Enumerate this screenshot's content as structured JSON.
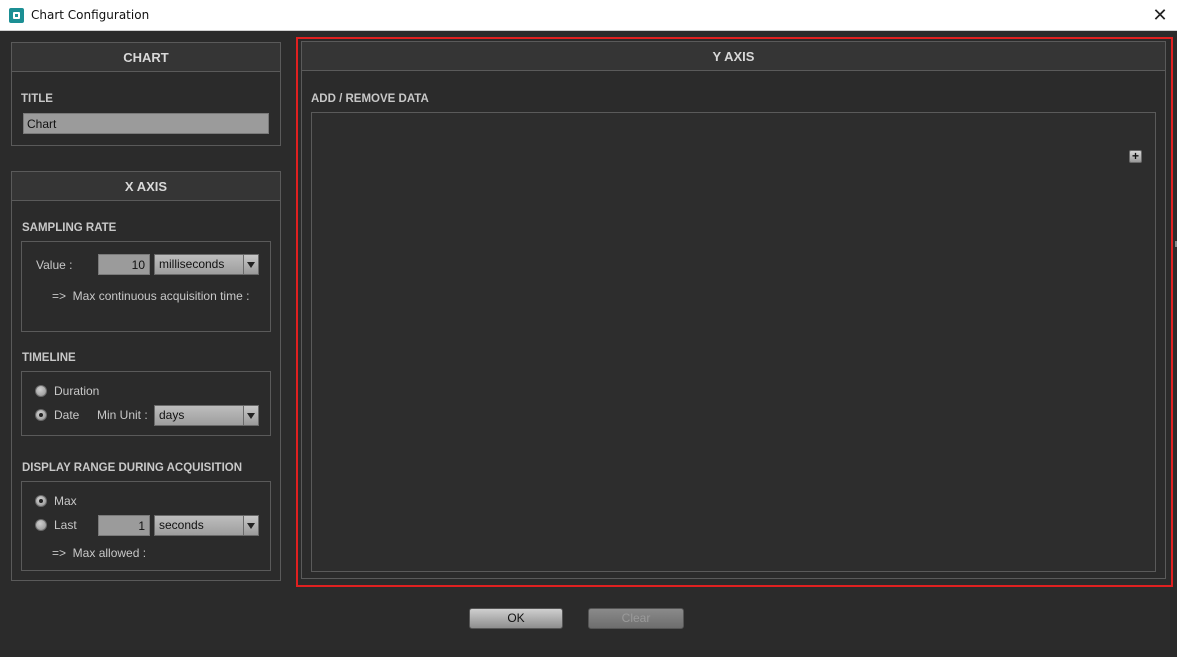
{
  "window": {
    "title": "Chart Configuration",
    "close_glyph": "✕"
  },
  "chart_panel": {
    "header": "CHART",
    "title_label": "TITLE",
    "title_value": "Chart"
  },
  "x_axis_panel": {
    "header": "X AXIS",
    "sampling_rate": {
      "label": "SAMPLING RATE",
      "value_label": "Value :",
      "value": "10",
      "unit": "milliseconds",
      "max_time_text": "=>  Max continuous acquisition time :"
    },
    "timeline": {
      "label": "TIMELINE",
      "duration_label": "Duration",
      "date_label": "Date",
      "min_unit_label": "Min Unit :",
      "min_unit_value": "days",
      "selected": "Date"
    },
    "display_range": {
      "label": "DISPLAY RANGE DURING ACQUISITION",
      "max_label": "Max",
      "last_label": "Last",
      "last_value": "1",
      "last_unit": "seconds",
      "max_allowed_text": "=>  Max allowed :",
      "selected": "Max"
    }
  },
  "y_axis_panel": {
    "header": "Y AXIS",
    "add_remove_label": "ADD / REMOVE DATA",
    "add_glyph": "+"
  },
  "footer": {
    "ok_label": "OK",
    "clear_label": "Clear"
  },
  "colors": {
    "background": "#2b2b2b",
    "highlight_outline": "#e02020",
    "app_icon": "#1b8f94"
  },
  "icons": {
    "app": "app-icon",
    "close": "close-icon",
    "dropdown": "chevron-down-icon",
    "add": "plus-icon"
  }
}
